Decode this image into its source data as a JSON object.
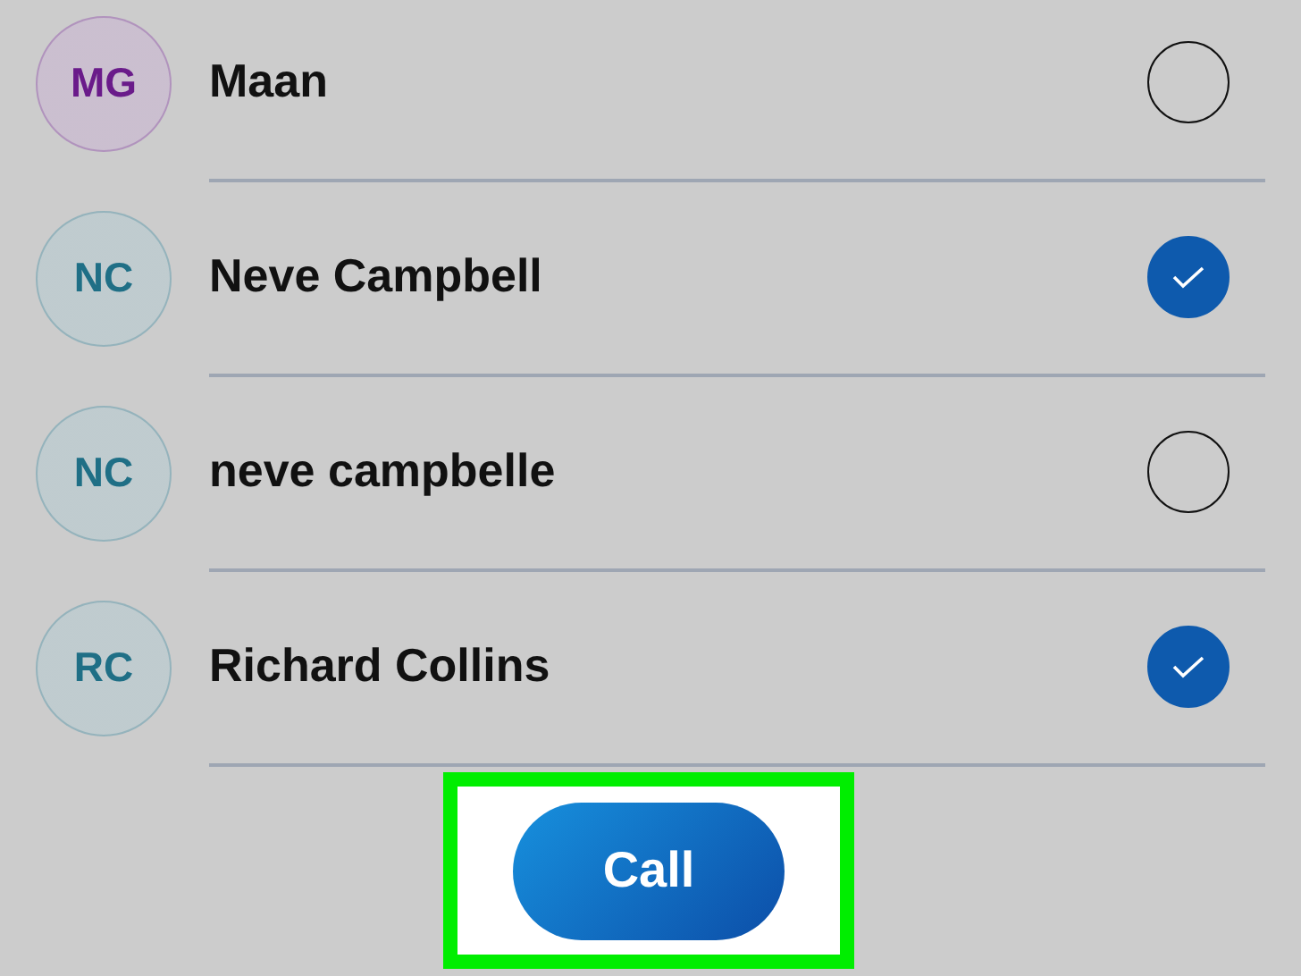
{
  "contacts": [
    {
      "initials": "MG",
      "name": "Maan",
      "color": "#6a1b8a",
      "checked": false
    },
    {
      "initials": "NC",
      "name": "Neve Campbell",
      "color": "#1f6f86",
      "checked": true
    },
    {
      "initials": "NC",
      "name": "neve campbelle",
      "color": "#1f6f86",
      "checked": false
    },
    {
      "initials": "RC",
      "name": "Richard Collins",
      "color": "#1f6f86",
      "checked": true
    }
  ],
  "call_button": {
    "label": "Call",
    "highlighted": true
  }
}
